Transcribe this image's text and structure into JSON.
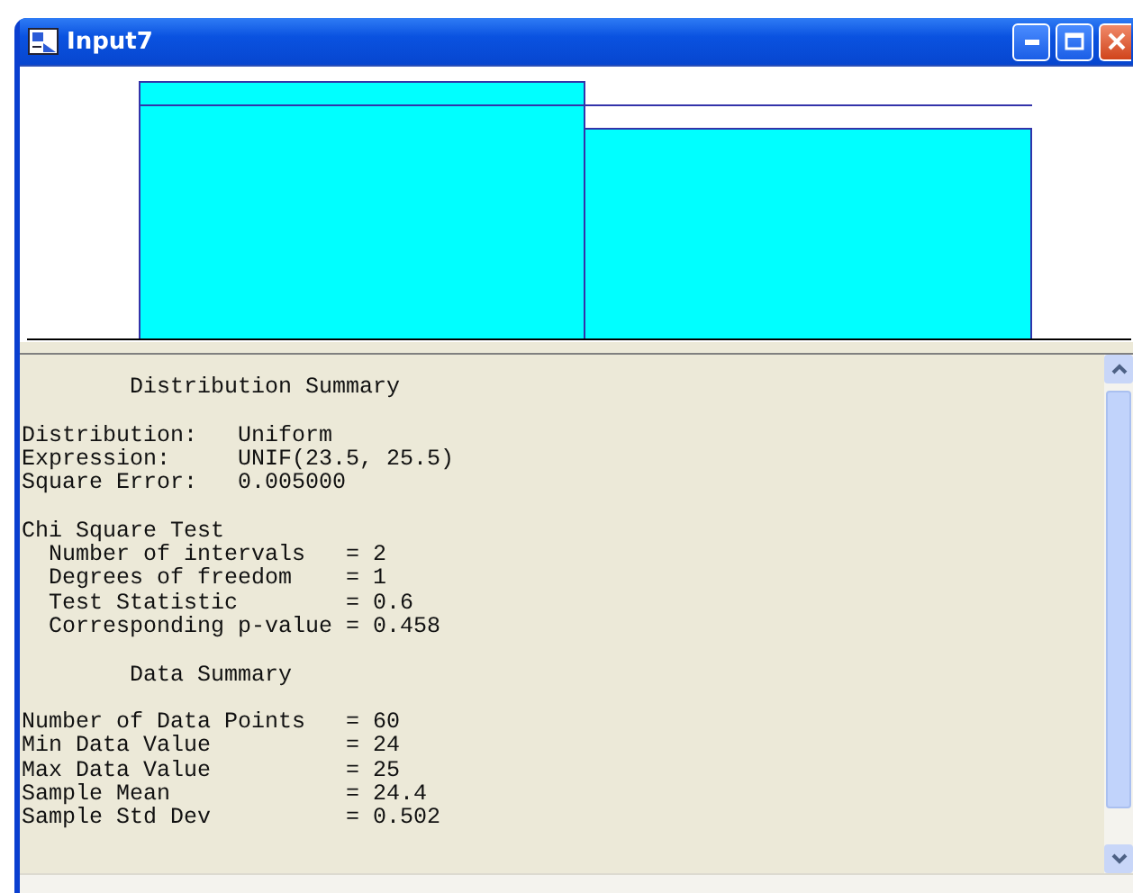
{
  "window": {
    "title": "Input7"
  },
  "report": [
    {
      "kind": "title",
      "text": "Distribution Summary"
    },
    {
      "kind": "fields",
      "rows": [
        {
          "label": "Distribution:",
          "value": "Uniform"
        },
        {
          "label": "Expression:",
          "value": "UNIF(23.5, 25.5)"
        },
        {
          "label": "Square Error:",
          "value": "0.005000"
        }
      ]
    },
    {
      "kind": "test",
      "heading": "Chi Square Test",
      "rows": [
        {
          "label": "Number of intervals",
          "value": "= 2"
        },
        {
          "label": "Degrees of freedom",
          "value": "= 1"
        },
        {
          "label": "Test Statistic",
          "value": "= 0.6"
        },
        {
          "label": "Corresponding p-value",
          "value": "= 0.458"
        }
      ]
    },
    {
      "kind": "title",
      "text": "Data Summary"
    },
    {
      "kind": "stats",
      "rows": [
        {
          "label": "Number of Data Points",
          "value": "= 60"
        },
        {
          "label": "Min Data Value",
          "value": "= 24"
        },
        {
          "label": "Max Data Value",
          "value": "= 25"
        },
        {
          "label": "Sample Mean",
          "value": "= 24.4"
        },
        {
          "label": "Sample Std Dev",
          "value": "= 0.502"
        }
      ]
    }
  ]
}
